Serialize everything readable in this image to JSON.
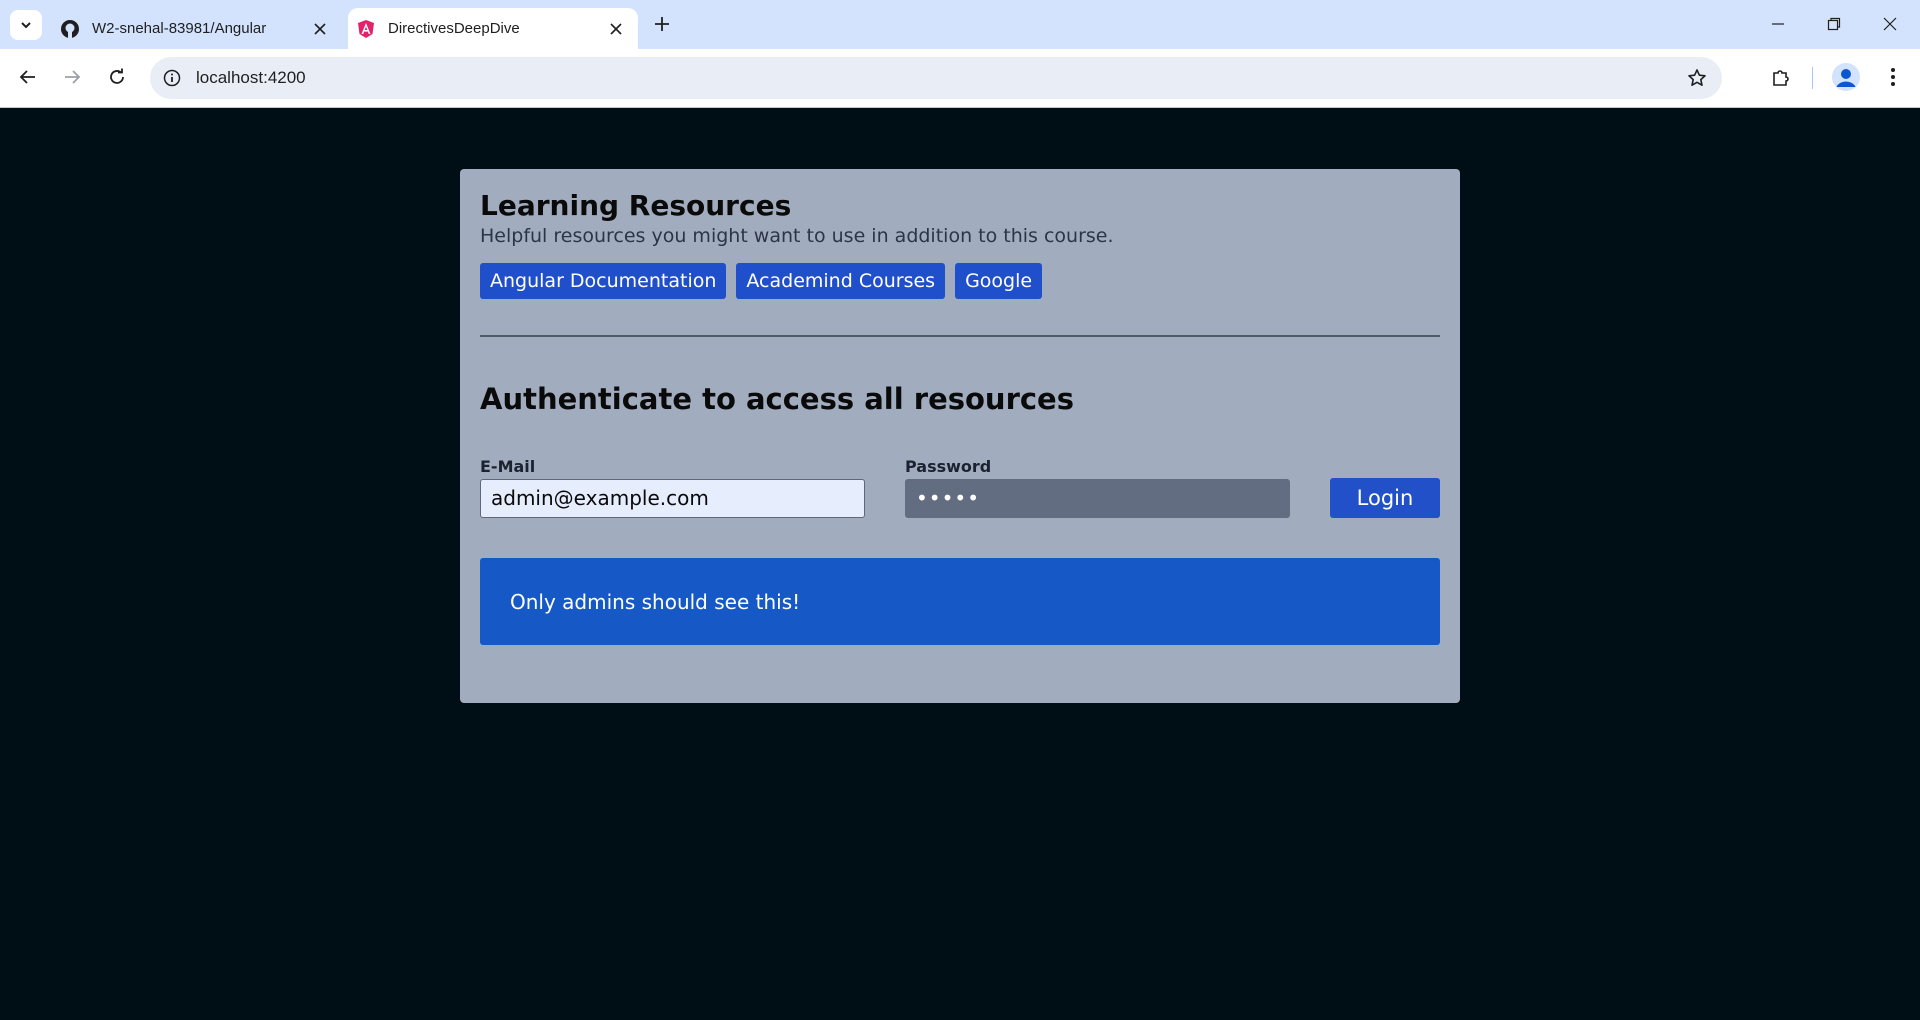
{
  "browser": {
    "tabs": [
      {
        "title": "W2-snehal-83981/Angular",
        "icon": "github-icon",
        "active": false
      },
      {
        "title": "DirectivesDeepDive",
        "icon": "angular-icon",
        "active": true
      }
    ],
    "url": "localhost:4200"
  },
  "page": {
    "resources": {
      "title": "Learning Resources",
      "subtitle": "Helpful resources you might want to use in addition to this course.",
      "links": [
        {
          "label": "Angular Documentation"
        },
        {
          "label": "Academind Courses"
        },
        {
          "label": "Google"
        }
      ]
    },
    "auth": {
      "heading": "Authenticate to access all resources",
      "email_label": "E-Mail",
      "email_value": "admin@example.com",
      "password_label": "Password",
      "password_value": "•••••",
      "login_label": "Login"
    },
    "admin_message": "Only admins should see this!"
  },
  "colors": {
    "page_bg": "#000e16",
    "card_bg": "#a1adbf",
    "button_blue": "#1f4fcb",
    "admin_box": "#1659c6"
  }
}
